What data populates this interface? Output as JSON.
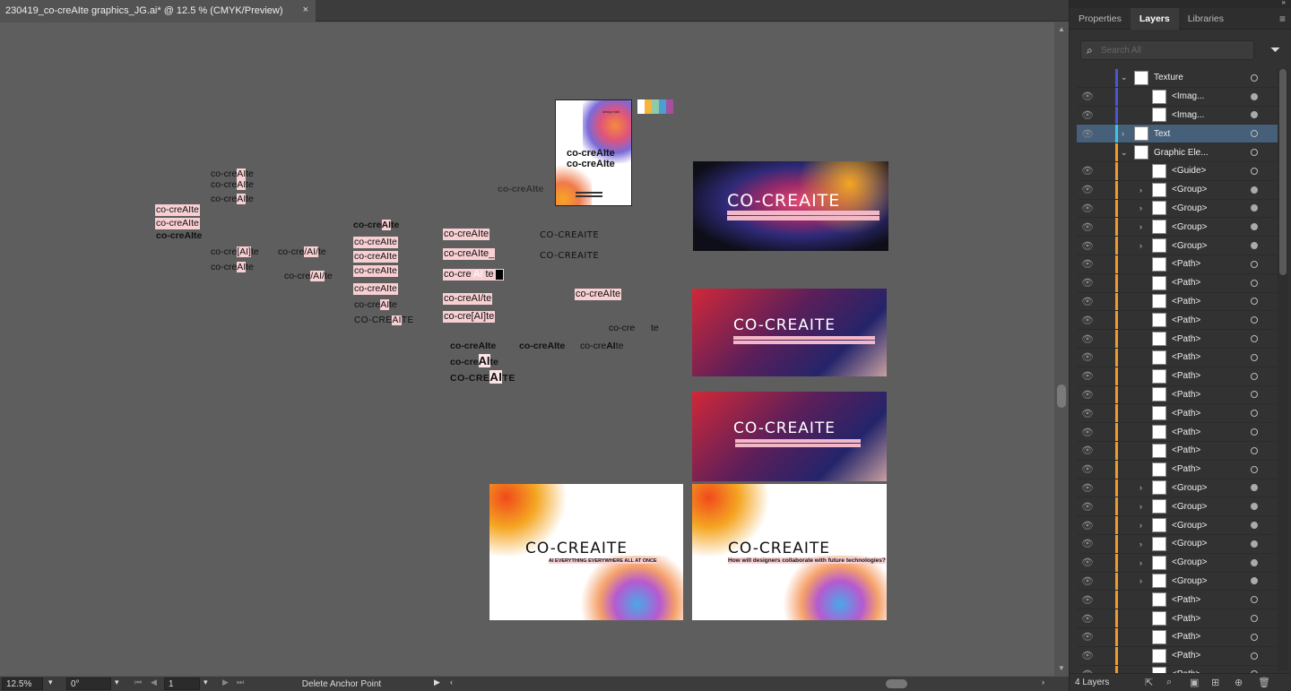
{
  "document": {
    "tab_title": "230419_co-creAIte graphics_JG.ai* @ 12.5 % (CMYK/Preview)",
    "close": "×"
  },
  "canvas": {
    "poster_small": {
      "tag": "design talk",
      "line1": "co-creAIte",
      "line2": "co-creAIte",
      "footer": "AI EVERYTHING EVERYWHERE ALL AT ONCE"
    },
    "swatch_colors": [
      "#ffffff",
      "#f5b53a",
      "#8fc9a8",
      "#4aa0d0",
      "#a64fa0"
    ],
    "word": "co-creAIte",
    "words_left": [
      "co-creAIte",
      "co-creAIte",
      "co-creAIte",
      "co-creAIte",
      "co-creAIte",
      "co-creAIte",
      "co-cre[AI]te",
      "co-creAIte",
      "co-cre/AI/te",
      "co-cre/AI/te"
    ],
    "words_col3": [
      "co-creAIte",
      "co-creAIte",
      "co-creAIte",
      "co-creAIte",
      "co-creAIte",
      "co-creAIte",
      "co-creAIte",
      "CO-CREAITE"
    ],
    "words_col4": [
      "co-creAIte",
      "co-creAIte_",
      "co-creAIte",
      "co-creAI/te",
      "co-cre[AI]te"
    ],
    "words_col4b": [
      "co-creAIte",
      "co-creAIte",
      "CO-CREAITE",
      "co-creAIte",
      "co-creAIte"
    ],
    "words_col5": [
      "CO-CREAITE",
      "CO-CREAITE",
      "co-creAIte",
      "co-creAIte",
      "co-cre",
      "te"
    ],
    "artboards": {
      "dark1": {
        "title": "CO-CREAITE",
        "sub1": "",
        "sub2": ""
      },
      "dark2": {
        "title": "CO-CREAITE"
      },
      "dark3": {
        "title": "CO-CREAITE"
      },
      "light1": {
        "title": "CO-CREAITE",
        "tagline": "AI EVERYTHING EVERYWHERE ALL AT ONCE"
      },
      "light2": {
        "title": "CO-CREAITE",
        "tagline": "How will designers collaborate with future technologies?"
      }
    }
  },
  "status": {
    "zoom": "12.5%",
    "rotate": "0°",
    "artboard_num": "1",
    "tool_hint": "Delete Anchor Point"
  },
  "panel": {
    "tabs": [
      "Properties",
      "Layers",
      "Libraries"
    ],
    "search_placeholder": "Search All",
    "footer_label": "4 Layers",
    "layers": [
      {
        "name": "Texture",
        "level": 0,
        "expanded": true,
        "color": "#4a55d8",
        "eye": false,
        "circle": "open"
      },
      {
        "name": "<Imag...",
        "level": 1,
        "color": "#4a55d8",
        "eye": true,
        "circle": "fill"
      },
      {
        "name": "<Imag...",
        "level": 1,
        "color": "#4a55d8",
        "eye": true,
        "circle": "fill"
      },
      {
        "name": "Text",
        "level": 0,
        "collapsed": true,
        "color": "#3ec6e8",
        "eye": true,
        "circle": "open",
        "selected": true
      },
      {
        "name": "Graphic Ele...",
        "level": 0,
        "expanded": true,
        "color": "#f19a2a",
        "eye": false,
        "circle": "open"
      },
      {
        "name": "<Guide>",
        "level": 1,
        "color": "#f19a2a",
        "eye": true,
        "circle": "open"
      },
      {
        "name": "<Group>",
        "level": 1,
        "arrow": true,
        "color": "#f19a2a",
        "eye": true,
        "circle": "fill"
      },
      {
        "name": "<Group>",
        "level": 1,
        "arrow": true,
        "color": "#f19a2a",
        "eye": true,
        "circle": "fill"
      },
      {
        "name": "<Group>",
        "level": 1,
        "arrow": true,
        "color": "#f19a2a",
        "eye": true,
        "circle": "fill"
      },
      {
        "name": "<Group>",
        "level": 1,
        "arrow": true,
        "color": "#f19a2a",
        "eye": true,
        "circle": "fill"
      },
      {
        "name": "<Path>",
        "level": 1,
        "color": "#f19a2a",
        "eye": true,
        "circle": "open"
      },
      {
        "name": "<Path>",
        "level": 1,
        "color": "#f19a2a",
        "eye": true,
        "circle": "open"
      },
      {
        "name": "<Path>",
        "level": 1,
        "color": "#f19a2a",
        "eye": true,
        "circle": "open"
      },
      {
        "name": "<Path>",
        "level": 1,
        "color": "#f19a2a",
        "eye": true,
        "circle": "open"
      },
      {
        "name": "<Path>",
        "level": 1,
        "color": "#f19a2a",
        "eye": true,
        "circle": "open"
      },
      {
        "name": "<Path>",
        "level": 1,
        "color": "#f19a2a",
        "eye": true,
        "circle": "open"
      },
      {
        "name": "<Path>",
        "level": 1,
        "color": "#f19a2a",
        "eye": true,
        "circle": "open"
      },
      {
        "name": "<Path>",
        "level": 1,
        "color": "#f19a2a",
        "eye": true,
        "circle": "open"
      },
      {
        "name": "<Path>",
        "level": 1,
        "color": "#f19a2a",
        "eye": true,
        "circle": "open"
      },
      {
        "name": "<Path>",
        "level": 1,
        "color": "#f19a2a",
        "eye": true,
        "circle": "open"
      },
      {
        "name": "<Path>",
        "level": 1,
        "color": "#f19a2a",
        "eye": true,
        "circle": "open"
      },
      {
        "name": "<Path>",
        "level": 1,
        "color": "#f19a2a",
        "eye": true,
        "circle": "open"
      },
      {
        "name": "<Group>",
        "level": 1,
        "arrow": true,
        "color": "#f19a2a",
        "eye": true,
        "circle": "fill"
      },
      {
        "name": "<Group>",
        "level": 1,
        "arrow": true,
        "color": "#f19a2a",
        "eye": true,
        "circle": "fill"
      },
      {
        "name": "<Group>",
        "level": 1,
        "arrow": true,
        "color": "#f19a2a",
        "eye": true,
        "circle": "fill"
      },
      {
        "name": "<Group>",
        "level": 1,
        "arrow": true,
        "color": "#f19a2a",
        "eye": true,
        "circle": "fill"
      },
      {
        "name": "<Group>",
        "level": 1,
        "arrow": true,
        "color": "#f19a2a",
        "eye": true,
        "circle": "fill"
      },
      {
        "name": "<Group>",
        "level": 1,
        "arrow": true,
        "color": "#f19a2a",
        "eye": true,
        "circle": "fill"
      },
      {
        "name": "<Path>",
        "level": 1,
        "color": "#f19a2a",
        "eye": true,
        "circle": "open"
      },
      {
        "name": "<Path>",
        "level": 1,
        "color": "#f19a2a",
        "eye": true,
        "circle": "open"
      },
      {
        "name": "<Path>",
        "level": 1,
        "color": "#f19a2a",
        "eye": true,
        "circle": "open"
      },
      {
        "name": "<Path>",
        "level": 1,
        "color": "#f19a2a",
        "eye": true,
        "circle": "open"
      },
      {
        "name": "<Path>",
        "level": 1,
        "color": "#f19a2a",
        "eye": true,
        "circle": "open"
      }
    ]
  }
}
